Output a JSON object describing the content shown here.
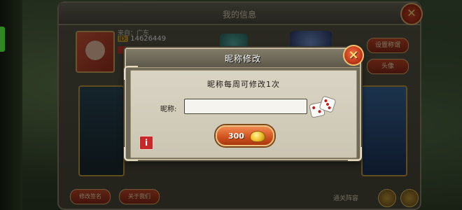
{
  "background_panel": {
    "title": "我的信息",
    "origin_text": "来自：广东",
    "id_tag": "ID:",
    "id_value": "14626449",
    "side_buttons": [
      "设置称谓",
      "头像"
    ],
    "bottom_buttons": [
      "修改签名",
      "关于我们"
    ],
    "bottom_right_label": "通关阵容"
  },
  "modal": {
    "title": "昵称修改",
    "close_icon": "×",
    "notice": "昵称每周可修改1次",
    "nickname_label": "昵称:",
    "nickname_value": "",
    "nickname_placeholder": "",
    "price_value": "300",
    "info_icon": "i"
  },
  "colors": {
    "accent_orange": "#d35420",
    "close_red": "#c0381a",
    "gold": "#f2c230",
    "panel_beige": "#d9d4c4"
  }
}
